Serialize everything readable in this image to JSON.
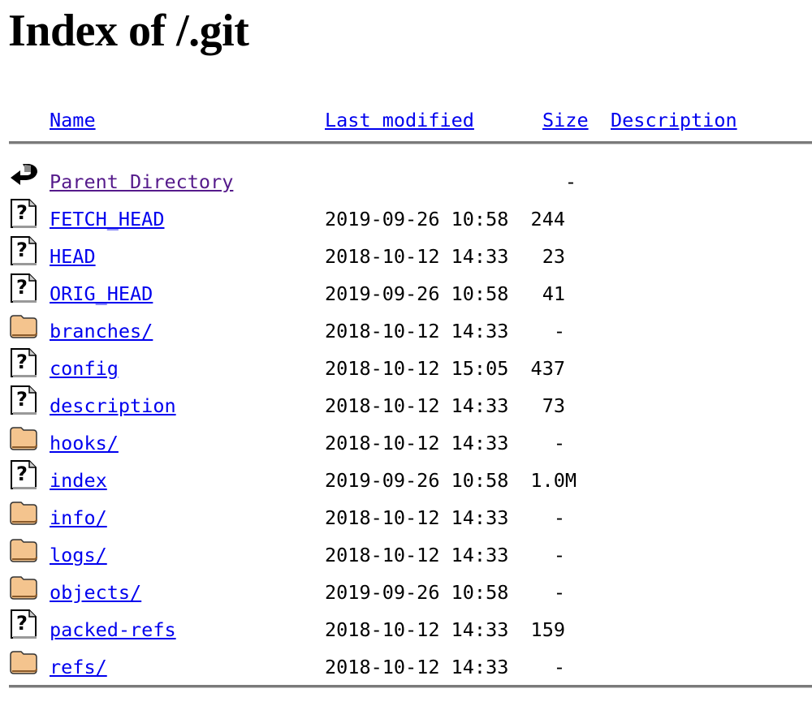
{
  "title": "Index of /.git",
  "columns": {
    "name": "Name",
    "last_modified": "Last modified",
    "size": "Size",
    "description": "Description"
  },
  "colors": {
    "link": "#0000ee",
    "visited_link": "#551a8b",
    "rule": "#7a7a7a"
  },
  "rows": [
    {
      "icon": "back-icon",
      "name": "Parent Directory",
      "date": "",
      "size": "-",
      "visited": true
    },
    {
      "icon": "unknown-file-icon",
      "name": "FETCH_HEAD",
      "date": "2019-09-26 10:58",
      "size": "244"
    },
    {
      "icon": "unknown-file-icon",
      "name": "HEAD",
      "date": "2018-10-12 14:33",
      "size": "23"
    },
    {
      "icon": "unknown-file-icon",
      "name": "ORIG_HEAD",
      "date": "2019-09-26 10:58",
      "size": "41"
    },
    {
      "icon": "folder-icon",
      "name": "branches/",
      "date": "2018-10-12 14:33",
      "size": "-"
    },
    {
      "icon": "unknown-file-icon",
      "name": "config",
      "date": "2018-10-12 15:05",
      "size": "437"
    },
    {
      "icon": "unknown-file-icon",
      "name": "description",
      "date": "2018-10-12 14:33",
      "size": "73"
    },
    {
      "icon": "folder-icon",
      "name": "hooks/",
      "date": "2018-10-12 14:33",
      "size": "-"
    },
    {
      "icon": "unknown-file-icon",
      "name": "index",
      "date": "2019-09-26 10:58",
      "size": "1.0M"
    },
    {
      "icon": "folder-icon",
      "name": "info/",
      "date": "2018-10-12 14:33",
      "size": "-"
    },
    {
      "icon": "folder-icon",
      "name": "logs/",
      "date": "2018-10-12 14:33",
      "size": "-"
    },
    {
      "icon": "folder-icon",
      "name": "objects/",
      "date": "2019-09-26 10:58",
      "size": "-"
    },
    {
      "icon": "unknown-file-icon",
      "name": "packed-refs",
      "date": "2018-10-12 14:33",
      "size": "159"
    },
    {
      "icon": "folder-icon",
      "name": "refs/",
      "date": "2018-10-12 14:33",
      "size": "-"
    }
  ]
}
